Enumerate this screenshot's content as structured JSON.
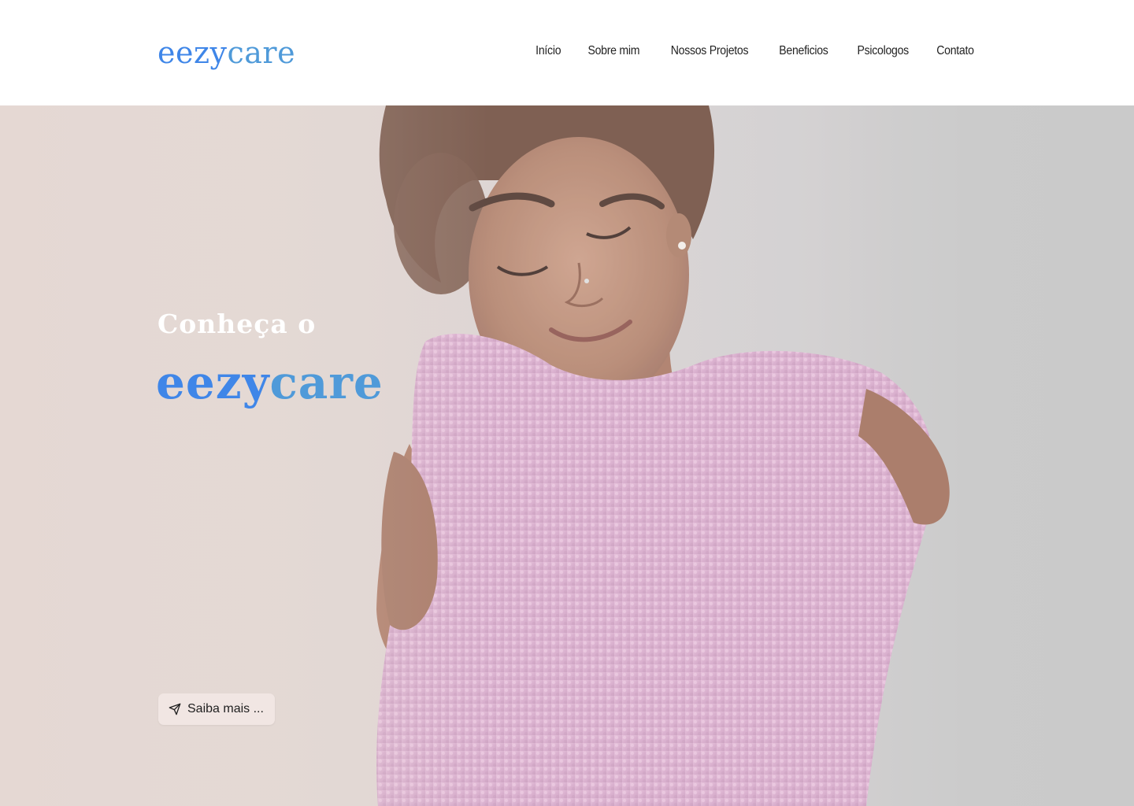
{
  "brand": {
    "part_a": "eezy",
    "part_b": "care",
    "color_a": "#3f86e8",
    "color_b": "#4f9ad9"
  },
  "nav": {
    "items": [
      {
        "label": "Início"
      },
      {
        "label": "Sobre mim"
      },
      {
        "label": "Nossos Projetos"
      },
      {
        "label": "Beneficios"
      },
      {
        "label": "Psicologos"
      },
      {
        "label": "Contato"
      }
    ]
  },
  "hero": {
    "eyebrow": "Conheça o",
    "title_a": "eezy",
    "title_b": "care",
    "cta_label": "Saiba mais ...",
    "cta_icon": "send-icon",
    "image": "woman-hugging-herself-in-pink-sweater"
  }
}
